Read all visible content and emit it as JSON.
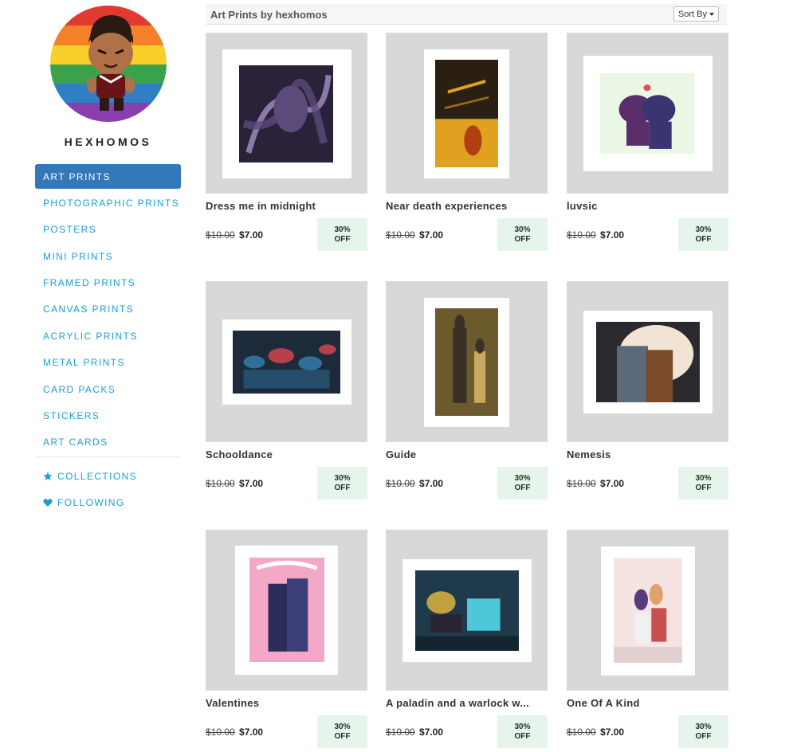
{
  "shop": {
    "name": "HEXHOMOS"
  },
  "nav": {
    "items": [
      {
        "label": "ART PRINTS",
        "active": true
      },
      {
        "label": "PHOTOGRAPHIC PRINTS",
        "active": false
      },
      {
        "label": "POSTERS",
        "active": false
      },
      {
        "label": "MINI PRINTS",
        "active": false
      },
      {
        "label": "FRAMED PRINTS",
        "active": false
      },
      {
        "label": "CANVAS PRINTS",
        "active": false
      },
      {
        "label": "ACRYLIC PRINTS",
        "active": false
      },
      {
        "label": "METAL PRINTS",
        "active": false
      },
      {
        "label": "CARD PACKS",
        "active": false
      },
      {
        "label": "STICKERS",
        "active": false
      },
      {
        "label": "ART CARDS",
        "active": false
      }
    ],
    "collections": {
      "label": "COLLECTIONS",
      "icon": "star-icon"
    },
    "following": {
      "label": "FOLLOWING",
      "icon": "heart-icon"
    }
  },
  "header": {
    "title": "Art Prints by hexhomos",
    "sort_label": "Sort By"
  },
  "colors": {
    "accent": "#3379b8",
    "link": "#1a9ed5",
    "badge_bg": "#e6f4ec",
    "thumb_bg": "#d8d8d8"
  },
  "products": [
    {
      "title": "Dress me in midnight",
      "old_price": "$10.00",
      "new_price": "$7.00",
      "discount_line1": "30%",
      "discount_line2": "OFF",
      "orientation": "square",
      "palette": [
        "#2a2238",
        "#5b4a7a",
        "#8b7aa8"
      ]
    },
    {
      "title": "Near death experiences",
      "old_price": "$10.00",
      "new_price": "$7.00",
      "discount_line1": "30%",
      "discount_line2": "OFF",
      "orientation": "portrait",
      "palette": [
        "#2b1e12",
        "#e0a020",
        "#b04010"
      ]
    },
    {
      "title": "luvsic",
      "old_price": "$10.00",
      "new_price": "$7.00",
      "discount_line1": "30%",
      "discount_line2": "OFF",
      "orientation": "square",
      "palette": [
        "#e9f7e4",
        "#5a2d6b",
        "#3a3470"
      ]
    },
    {
      "title": "Schooldance",
      "old_price": "$10.00",
      "new_price": "$7.00",
      "discount_line1": "30%",
      "discount_line2": "OFF",
      "orientation": "landscape",
      "palette": [
        "#1c2a3a",
        "#2f6f9a",
        "#b8404a"
      ]
    },
    {
      "title": "Guide",
      "old_price": "$10.00",
      "new_price": "$7.00",
      "discount_line1": "30%",
      "discount_line2": "OFF",
      "orientation": "portrait",
      "palette": [
        "#6b5a2c",
        "#3a3028",
        "#c8a860"
      ]
    },
    {
      "title": "Nemesis",
      "old_price": "$10.00",
      "new_price": "$7.00",
      "discount_line1": "30%",
      "discount_line2": "OFF",
      "orientation": "landscape",
      "palette": [
        "#2a2a2e",
        "#f2e4d4",
        "#5a6a7a"
      ]
    },
    {
      "title": "Valentines",
      "old_price": "$10.00",
      "new_price": "$7.00",
      "discount_line1": "30%",
      "discount_line2": "OFF",
      "orientation": "portrait",
      "palette": [
        "#f4a8c8",
        "#2b2c5a",
        "#ffffff"
      ]
    },
    {
      "title": "A paladin and a warlock w...",
      "old_price": "$10.00",
      "new_price": "$7.00",
      "discount_line1": "30%",
      "discount_line2": "OFF",
      "orientation": "landscape",
      "palette": [
        "#1f3a4a",
        "#4ec8d8",
        "#2a2430"
      ]
    },
    {
      "title": "One Of A Kind",
      "old_price": "$10.00",
      "new_price": "$7.00",
      "discount_line1": "30%",
      "discount_line2": "OFF",
      "orientation": "portrait",
      "palette": [
        "#f6e4e2",
        "#c85050",
        "#2a3a6a"
      ]
    }
  ]
}
